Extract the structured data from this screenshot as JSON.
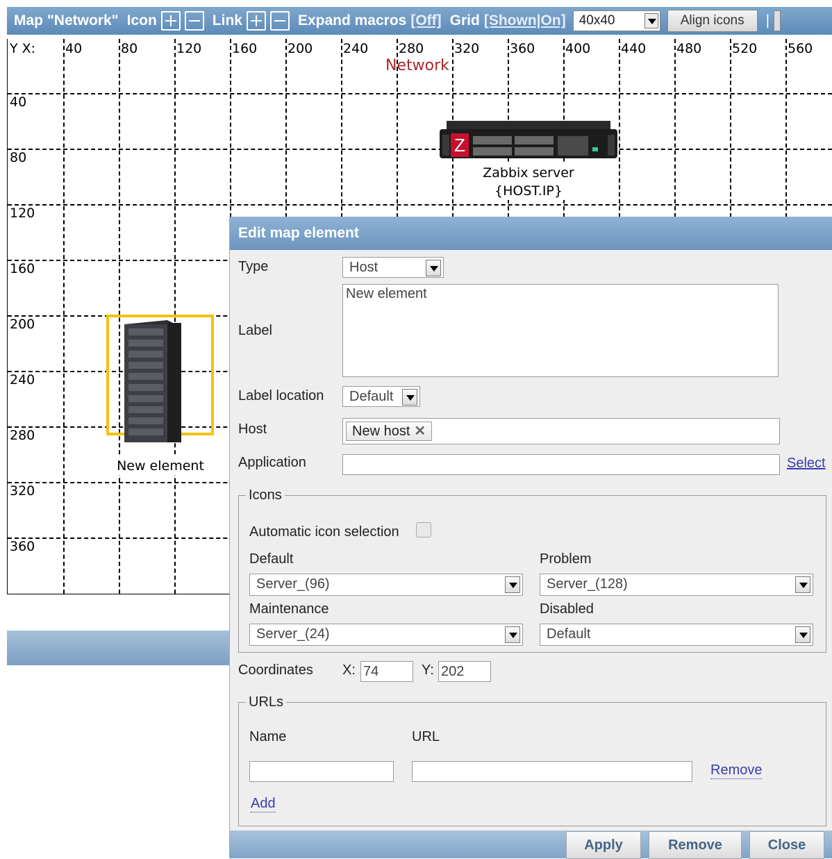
{
  "toolbar": {
    "title": "Map \"Network\"",
    "icon_label": "Icon",
    "link_label": "Link",
    "expand_macros_label": "Expand macros",
    "expand_macros_value": "[Off]",
    "grid_label": "Grid",
    "grid_value": "[Shown|On]",
    "grid_size": "40x40",
    "align_icons": "Align icons",
    "separator": "|"
  },
  "map": {
    "name": "Network",
    "corner_label": "Y X:",
    "x_ticks": [
      "40",
      "80",
      "120",
      "160",
      "200",
      "240",
      "280",
      "320",
      "360",
      "400",
      "440",
      "480",
      "520",
      "560"
    ],
    "y_ticks": [
      "40",
      "80",
      "120",
      "160",
      "200",
      "240",
      "280",
      "320",
      "360"
    ],
    "elements": [
      {
        "label_line1": "Zabbix server",
        "label_line2": "{HOST.IP}",
        "icon": "rack-server-icon"
      },
      {
        "label_line1": "New element",
        "icon": "tower-server-icon"
      }
    ]
  },
  "dialog": {
    "title": "Edit map element",
    "type_label": "Type",
    "type_value": "Host",
    "label_label": "Label",
    "label_value": "New element",
    "label_location_label": "Label location",
    "label_location_value": "Default",
    "host_label": "Host",
    "host_chip": "New host",
    "application_label": "Application",
    "application_value": "",
    "select_link": "Select",
    "icons_legend": "Icons",
    "auto_icon_label": "Automatic icon selection",
    "default_label": "Default",
    "default_value": "Server_(96)",
    "problem_label": "Problem",
    "problem_value": "Server_(128)",
    "maintenance_label": "Maintenance",
    "maintenance_value": "Server_(24)",
    "disabled_label": "Disabled",
    "disabled_value": "Default",
    "coordinates_label": "Coordinates",
    "x_label": "X:",
    "x_value": "74",
    "y_label": "Y:",
    "y_value": "202",
    "urls_legend": "URLs",
    "name_col": "Name",
    "url_col": "URL",
    "remove_link": "Remove",
    "add_link": "Add",
    "apply_button": "Apply",
    "remove_button": "Remove",
    "close_button": "Close"
  }
}
